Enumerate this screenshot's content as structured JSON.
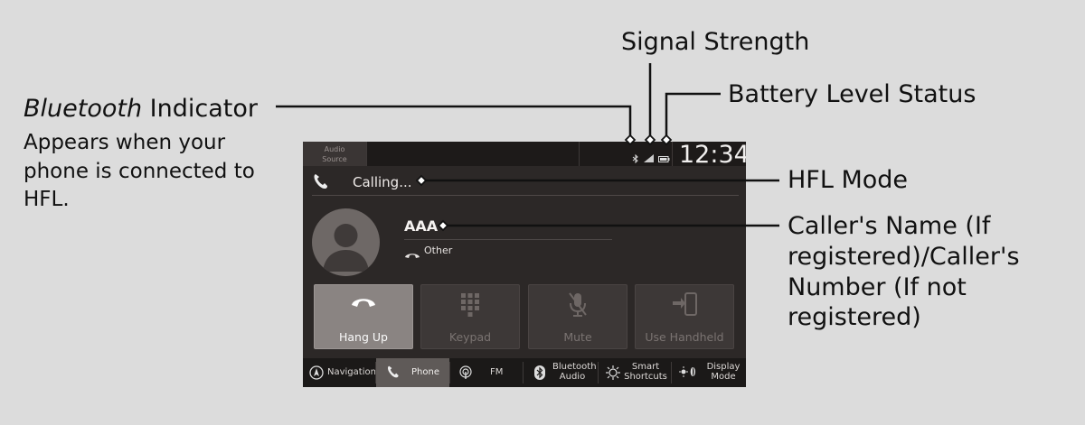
{
  "callouts": {
    "bluetooth_title_italic": "Bluetooth",
    "bluetooth_title_rest": " Indicator",
    "bluetooth_desc": [
      "Appears when your",
      "phone is connected to",
      "HFL."
    ],
    "signal": "Signal Strength",
    "battery": "Battery Level Status",
    "hfl": "HFL Mode",
    "caller": [
      "Caller's Name (If",
      "registered)/Caller's",
      "Number (If not",
      "registered)"
    ]
  },
  "screen": {
    "audio_source": [
      "Audio",
      "Source"
    ],
    "clock": "12:34",
    "status": "Calling...",
    "caller_name": "AAA",
    "call_type": "Other",
    "buttons": [
      {
        "label": "Hang Up",
        "icon": "hang-up-icon",
        "active": true
      },
      {
        "label": "Keypad",
        "icon": "keypad-icon",
        "active": false
      },
      {
        "label": "Mute",
        "icon": "mute-icon",
        "active": false
      },
      {
        "label": "Use Handheld",
        "icon": "handheld-icon",
        "active": false
      }
    ],
    "tabs": [
      {
        "label": "Navigation",
        "icon": "navigation-icon"
      },
      {
        "label": "Phone",
        "icon": "phone-icon",
        "active": true
      },
      {
        "label": "FM",
        "icon": "fm-icon"
      },
      {
        "label": [
          "Bluetooth",
          "Audio"
        ],
        "icon": "bluetooth-icon"
      },
      {
        "label": [
          "Smart",
          "Shortcuts"
        ],
        "icon": "smart-shortcuts-icon"
      },
      {
        "label": [
          "Display",
          "Mode"
        ],
        "icon": "display-mode-icon"
      }
    ]
  },
  "colors": {
    "background": "#dcdcdc",
    "screen": "#2c2827",
    "active_button": "#8a8482",
    "active_tab": "#5f5a58"
  }
}
